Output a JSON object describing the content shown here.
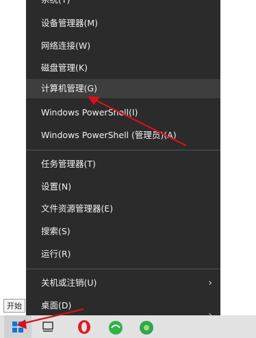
{
  "menu": {
    "top_partial": "系统(Y)",
    "items": [
      {
        "label": "设备管理器(M)"
      },
      {
        "label": "网络连接(W)"
      },
      {
        "label": "磁盘管理(K)"
      },
      {
        "label": "计算机管理(G)"
      },
      {
        "label": "Windows PowerShell(I)"
      },
      {
        "label": "Windows PowerShell (管理员)(A)"
      },
      {
        "label": "任务管理器(T)"
      },
      {
        "label": "设置(N)"
      },
      {
        "label": "文件资源管理器(E)"
      },
      {
        "label": "搜索(S)"
      },
      {
        "label": "运行(R)"
      },
      {
        "label": "关机或注销(U)"
      },
      {
        "label": "桌面(D)"
      }
    ]
  },
  "taskbar": {
    "tooltip": "开始",
    "icons": [
      "windows-start-icon",
      "task-view-icon",
      "opera-browser-icon",
      "green-app-icon",
      "green-media-icon"
    ]
  },
  "colors": {
    "menu_bg": "#2b2b2b",
    "highlight_bg": "#3e3e3e",
    "arrow": "#d7111b",
    "start_blue": "#0a78d7"
  }
}
